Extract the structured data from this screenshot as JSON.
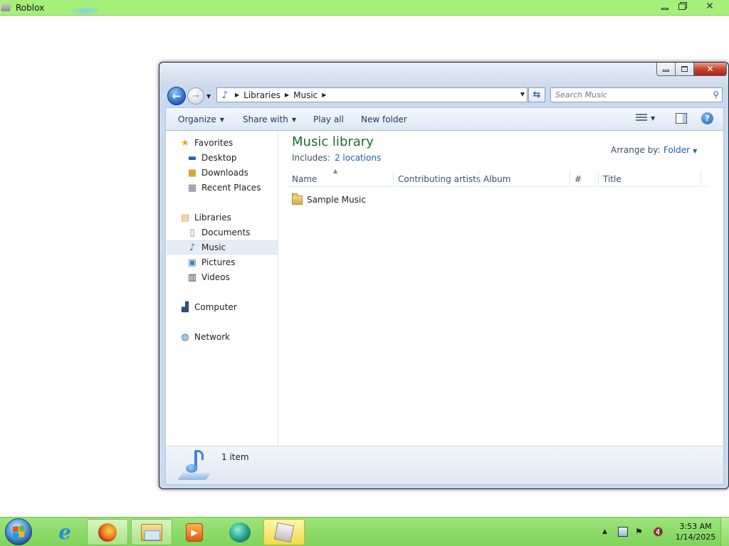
{
  "app_window": {
    "title": "Roblox",
    "controls": {
      "minimize": "minimize",
      "maximize": "restore",
      "close": "✕"
    }
  },
  "explorer": {
    "address": {
      "crumbs": [
        "Libraries",
        "Music"
      ]
    },
    "search": {
      "placeholder": "Search Music"
    },
    "toolbar": {
      "organize": "Organize",
      "share_with": "Share with",
      "play_all": "Play all",
      "new_folder": "New folder"
    },
    "nav_pane": {
      "favorites": {
        "label": "Favorites",
        "items": [
          "Desktop",
          "Downloads",
          "Recent Places"
        ]
      },
      "libraries": {
        "label": "Libraries",
        "items": [
          "Documents",
          "Music",
          "Pictures",
          "Videos"
        ],
        "selected": "Music"
      },
      "computer": "Computer",
      "network": "Network"
    },
    "library": {
      "title": "Music library",
      "includes_label": "Includes:",
      "includes_link": "2 locations",
      "arrange_label": "Arrange by:",
      "arrange_value": "Folder"
    },
    "columns": [
      "Name",
      "Contributing artists",
      "Album",
      "#",
      "Title"
    ],
    "rows": [
      {
        "name": "Sample Music",
        "type": "folder"
      }
    ],
    "details": {
      "count": "1 item"
    }
  },
  "taskbar": {
    "pinned": [
      "internet-explorer",
      "firefox",
      "windows-explorer",
      "media-player",
      "green-ball-app",
      "roblox"
    ],
    "clock": {
      "time": "3:53 AM",
      "date": "1/14/2025"
    }
  },
  "colors": {
    "app_titlebar": "#a6f07a",
    "taskbar": "#8fda6a",
    "library_title": "#1e6b2a",
    "link": "#1a5fb4"
  }
}
